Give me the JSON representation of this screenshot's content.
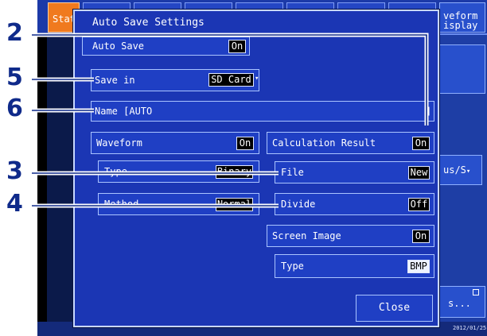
{
  "background": {
    "status_tab": "Stat",
    "right_panel_label": "veform\nisplay",
    "sample_button": "us/S",
    "scroll_button": "s...",
    "date": "2012/01/25"
  },
  "dialog": {
    "title": "Auto Save Settings",
    "auto_save": {
      "label": "Auto Save",
      "value": "On"
    },
    "save_in": {
      "label": "Save in",
      "value": "SD Card",
      "arrow": "▾"
    },
    "name": {
      "label": "Name [AUTO",
      "suffix": "]"
    },
    "waveform": {
      "label": "Waveform",
      "value": "On",
      "type": {
        "label": "Type",
        "value": "Binary"
      },
      "method": {
        "label": "Method",
        "value": "Normal"
      }
    },
    "calculation_result": {
      "label": "Calculation Result",
      "value": "On",
      "file": {
        "label": "File",
        "value": "New"
      },
      "divide": {
        "label": "Divide",
        "value": "Off"
      }
    },
    "screen_image": {
      "label": "Screen Image",
      "value": "On",
      "type": {
        "label": "Type",
        "value": "BMP"
      }
    },
    "close_label": "Close"
  },
  "callouts": [
    "2",
    "5",
    "6",
    "3",
    "4"
  ],
  "colors": {
    "dialog": "#1b36b4",
    "callout": "#0f2a8a",
    "status_tab": "#f07a1e"
  }
}
